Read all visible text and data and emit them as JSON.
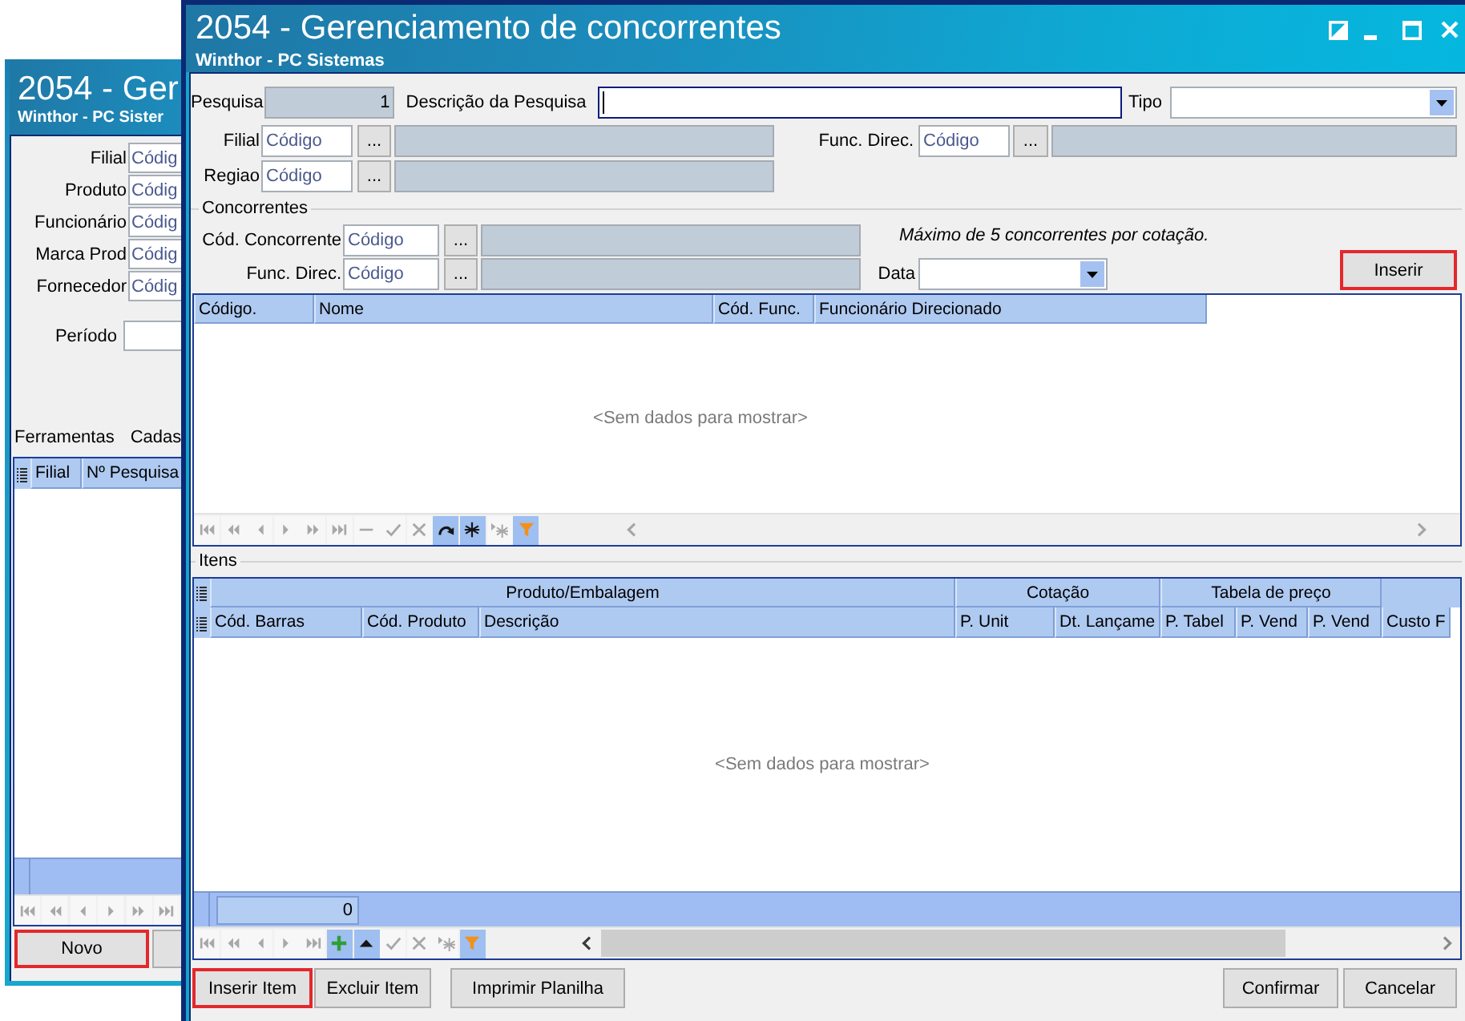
{
  "background_window": {
    "title": "2054 - Ger",
    "subtitle": "Winthor - PC Sister",
    "filters": [
      {
        "label": "Filial",
        "placeholder": "Códig"
      },
      {
        "label": "Produto",
        "placeholder": "Códig"
      },
      {
        "label": "Funcionário",
        "placeholder": "Códig"
      },
      {
        "label": "Marca Prod",
        "placeholder": "Códig"
      },
      {
        "label": "Fornecedor",
        "placeholder": "Códig"
      }
    ],
    "period": {
      "label": "Período"
    },
    "menu": [
      "Ferramentas",
      "Cadas"
    ],
    "grid": {
      "columns": [
        "Filial",
        "Nº Pesquisa"
      ],
      "nav": [
        {
          "kind": "first",
          "enabled": false
        },
        {
          "kind": "prev_page",
          "enabled": false
        },
        {
          "kind": "prev",
          "enabled": false
        },
        {
          "kind": "next",
          "enabled": false
        },
        {
          "kind": "next_page",
          "enabled": false
        },
        {
          "kind": "last",
          "enabled": false
        }
      ]
    },
    "buttons": [
      {
        "label": "Novo",
        "highlighted": true
      },
      {
        "highlighted": false
      }
    ]
  },
  "window": {
    "title": "2054 - Gerenciamento de concorrentes",
    "subtitle": "Winthor - PC Sistemas"
  },
  "search": {
    "id": {
      "label": "Pesquisa",
      "value": "1"
    },
    "description": {
      "label": "Descrição da Pesquisa",
      "focused": true
    },
    "type": {
      "label": "Tipo"
    },
    "branch": {
      "label": "Filial",
      "placeholder": "Código",
      "button": "..."
    },
    "director": {
      "label": "Func. Direc.",
      "placeholder": "Código",
      "button": "..."
    },
    "region": {
      "label": "Regiao",
      "placeholder": "Código",
      "button": "..."
    }
  },
  "competitors": {
    "title": "Concorrentes",
    "code": {
      "label": "Cód. Concorrente",
      "placeholder": "Código",
      "button": "..."
    },
    "director": {
      "label": "Func. Direc.",
      "placeholder": "Código",
      "button": "..."
    },
    "note": "Máximo de 5 concorrentes por cotação.",
    "date": {
      "label": "Data"
    },
    "insert_button": {
      "label": "Inserir",
      "highlighted": true
    },
    "grid": {
      "columns": [
        "Código.",
        "Nome",
        "Cód. Func.",
        "Funcionário Direcionado"
      ],
      "empty_text": "<Sem dados para mostrar>",
      "nav": [
        {
          "kind": "first",
          "enabled": false
        },
        {
          "kind": "prev_page",
          "enabled": false
        },
        {
          "kind": "prev",
          "enabled": false
        },
        {
          "kind": "next",
          "enabled": false
        },
        {
          "kind": "next_page",
          "enabled": false
        },
        {
          "kind": "last",
          "enabled": false
        },
        {
          "kind": "delete",
          "enabled": false
        },
        {
          "kind": "post",
          "enabled": false
        },
        {
          "kind": "cancel",
          "enabled": false
        },
        {
          "kind": "refresh",
          "enabled": true
        },
        {
          "kind": "insert",
          "enabled": true
        },
        {
          "kind": "append",
          "enabled": false
        },
        {
          "kind": "filter",
          "enabled": true
        }
      ]
    }
  },
  "items": {
    "title": "Itens",
    "grid": {
      "bands": [
        "Produto/Embalagem",
        "Cotação",
        "Tabela de preço"
      ],
      "columns": [
        "Cód. Barras",
        "Cód. Produto",
        "Descrição",
        "P. Unit",
        "Dt. Lançame",
        "P. Tabel",
        "P. Vend",
        "P. Vend",
        "Custo F"
      ],
      "empty_text": "<Sem dados para mostrar>",
      "footer_value": "0",
      "nav": [
        {
          "kind": "first",
          "enabled": false
        },
        {
          "kind": "prev_page",
          "enabled": false
        },
        {
          "kind": "prev",
          "enabled": false
        },
        {
          "kind": "next",
          "enabled": false
        },
        {
          "kind": "last",
          "enabled": false
        },
        {
          "kind": "add",
          "enabled": true
        },
        {
          "kind": "up",
          "enabled": true
        },
        {
          "kind": "post",
          "enabled": false
        },
        {
          "kind": "cancel",
          "enabled": false
        },
        {
          "kind": "append",
          "enabled": false
        },
        {
          "kind": "filter",
          "enabled": true
        }
      ]
    }
  },
  "buttons_left": [
    {
      "label": "Inserir Item",
      "highlighted": true
    },
    {
      "label": "Excluir Item",
      "highlighted": false
    },
    {
      "label": "Imprimir Planilha",
      "highlighted": false
    }
  ],
  "buttons_right": [
    {
      "label": "Confirmar",
      "highlighted": false
    },
    {
      "label": "Cancelar",
      "highlighted": false
    }
  ]
}
